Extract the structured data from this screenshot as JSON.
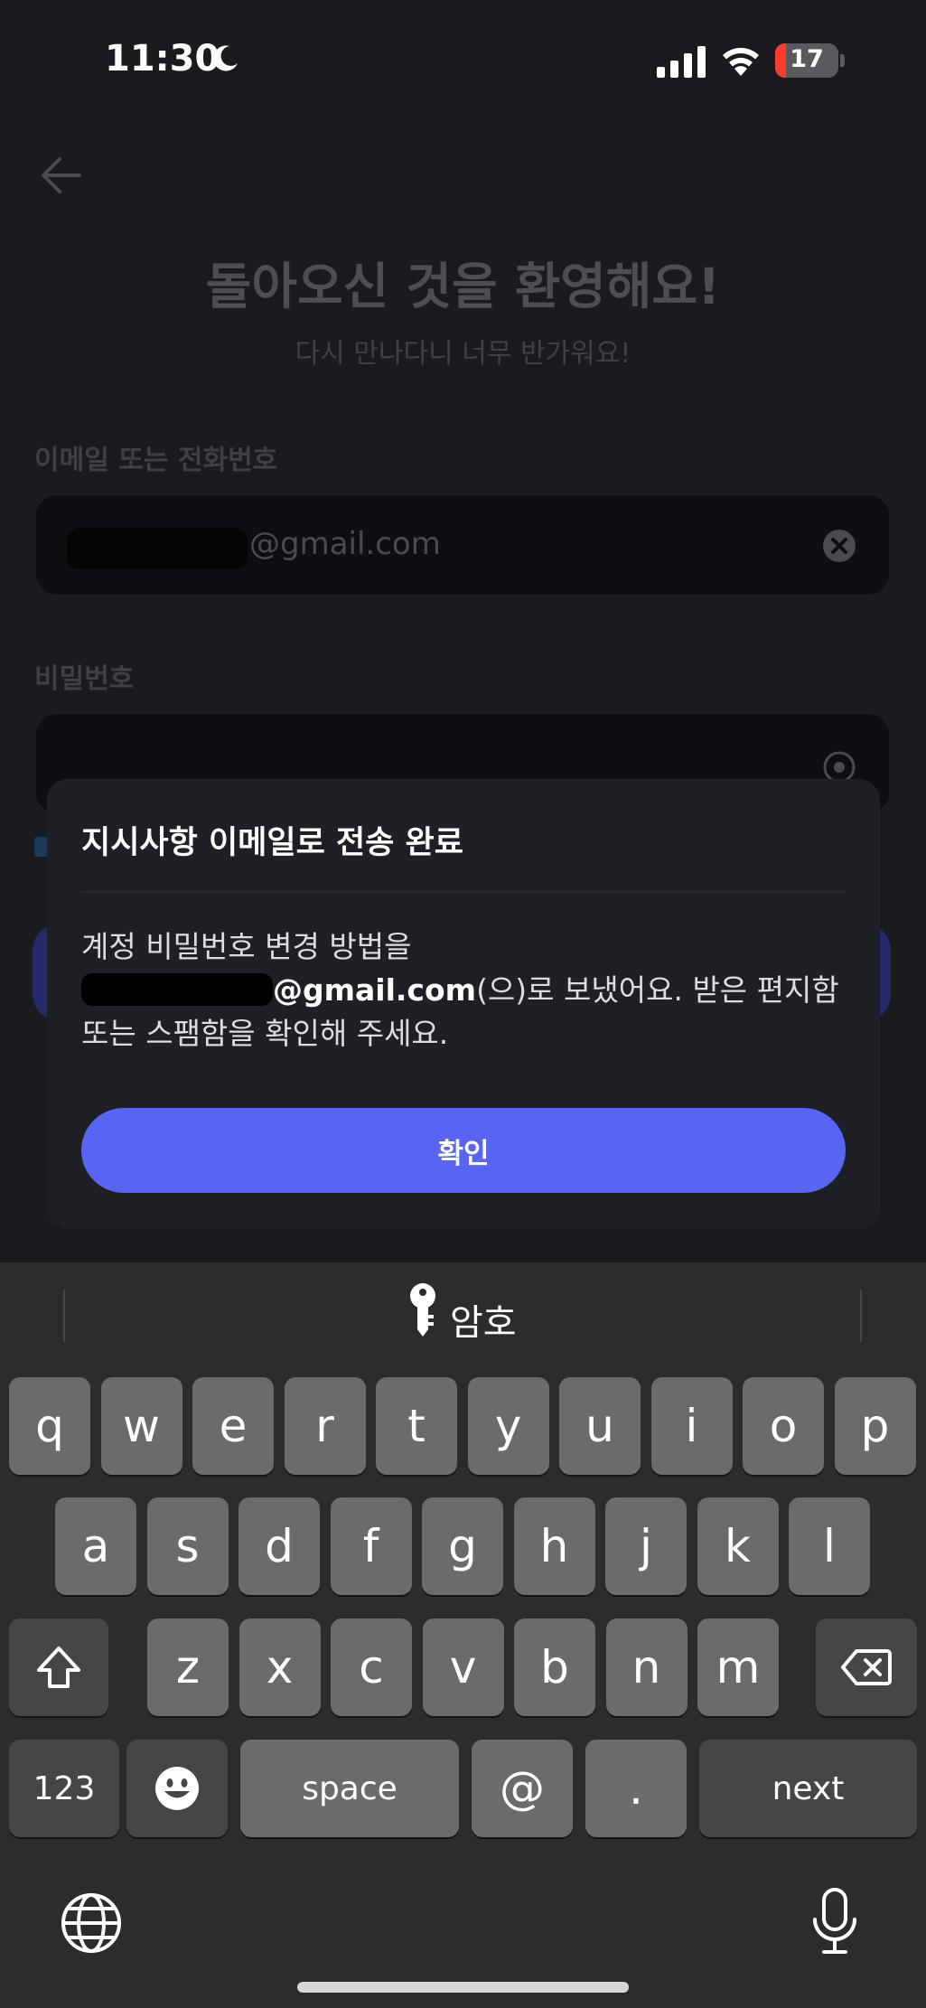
{
  "status_bar": {
    "time": "11:30",
    "battery": "17",
    "battery_level": 0.17,
    "icons": [
      "moon-icon",
      "signal-icon",
      "wifi-icon",
      "battery-icon"
    ]
  },
  "login": {
    "title": "돌아오신 것을 환영해요!",
    "subtitle": "다시 만나다니 너무 반가워요!",
    "email_label": "이메일 또는 전화번호",
    "email_value": "@gmail.com",
    "password_label": "비밀번호"
  },
  "dialog": {
    "title": "지시사항 이메일로 전송 완료",
    "body_line1": "계정 비밀번호 변경 방법을",
    "body_email": "@gmail.com",
    "body_line2_rest": "(으)로 보냈어요. 받은 편지함",
    "body_line3": "또는 스팸함을 확인해 주세요.",
    "confirm_label": "확인"
  },
  "keyboard": {
    "suggestion": "암호",
    "row1": [
      "q",
      "w",
      "e",
      "r",
      "t",
      "y",
      "u",
      "i",
      "o",
      "p"
    ],
    "row2": [
      "a",
      "s",
      "d",
      "f",
      "g",
      "h",
      "j",
      "k",
      "l"
    ],
    "row3": [
      "z",
      "x",
      "c",
      "v",
      "b",
      "n",
      "m"
    ],
    "numbers_label": "123",
    "space_label": "space",
    "at_label": "@",
    "period_label": ".",
    "next_label": "next"
  },
  "colors": {
    "accent": "#5865f2",
    "dialog_bg": "#1f2025",
    "keyboard_bg": "#2c2c2e",
    "battery_low": "#ff3b30"
  }
}
